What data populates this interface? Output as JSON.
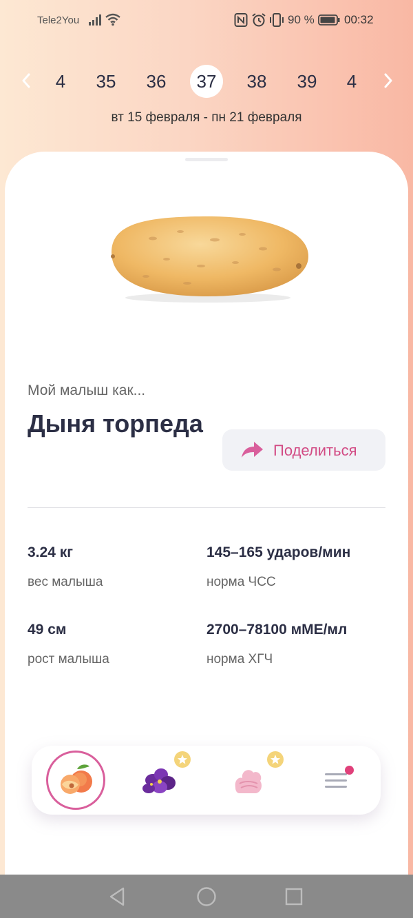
{
  "status_bar": {
    "carrier": "Tele2You",
    "battery_percent": "90 %",
    "time": "00:32",
    "icons": [
      "signal-icon",
      "wifi-icon",
      "nfc-icon",
      "alarm-icon",
      "vibrate-icon",
      "battery-icon"
    ]
  },
  "week_nav": {
    "weeks": [
      "4",
      "35",
      "36",
      "37",
      "38",
      "39",
      "4"
    ],
    "active_week": "37",
    "date_range": "вт 15 февраля - пн 21 февраля"
  },
  "baby": {
    "subtitle": "Мой малыш как...",
    "fruit_name": "Дыня торпеда",
    "share_label": "Поделиться",
    "image": "melon-torpedo-image"
  },
  "stats": [
    {
      "value": "3.24 кг",
      "label": "вес малыша"
    },
    {
      "value": "145–165 ударов/мин",
      "label": "норма ЧСС"
    },
    {
      "value": "49 см",
      "label": "рост малыша"
    },
    {
      "value": "2700–78100 мМЕ/мл",
      "label": "норма ХГЧ"
    }
  ],
  "tabs": [
    {
      "name": "peach-tab",
      "icon": "peach-icon",
      "active": true,
      "premium": false
    },
    {
      "name": "violet-tab",
      "icon": "violet-flower-icon",
      "active": false,
      "premium": true
    },
    {
      "name": "marshmallow-tab",
      "icon": "marshmallow-icon",
      "active": false,
      "premium": true
    },
    {
      "name": "menu-tab",
      "icon": "hamburger-menu-icon",
      "active": false,
      "notification": true
    }
  ],
  "colors": {
    "accent": "#d95f9c",
    "share_text": "#d24b84",
    "text_dark": "#2c2f45",
    "notification_dot": "#e0407a"
  }
}
